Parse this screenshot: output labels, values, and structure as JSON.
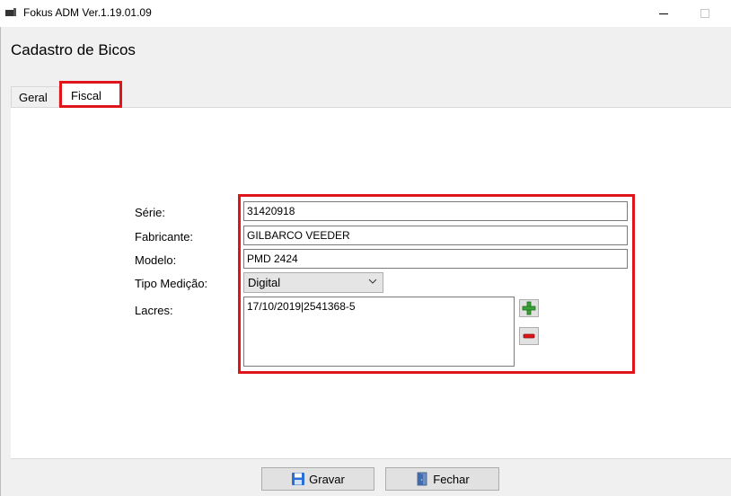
{
  "window": {
    "title": "Fokus ADM Ver.1.19.01.09"
  },
  "page": {
    "title": "Cadastro de Bicos"
  },
  "tabs": [
    {
      "label": "Geral",
      "active": false
    },
    {
      "label": "Fiscal",
      "active": true
    }
  ],
  "form": {
    "serie_label": "Série:",
    "serie_value": "31420918",
    "fabricante_label": "Fabricante:",
    "fabricante_value": "GILBARCO VEEDER",
    "modelo_label": "Modelo:",
    "modelo_value": "PMD 2424",
    "tipo_medicao_label": "Tipo Medição:",
    "tipo_medicao_value": "Digital",
    "lacres_label": "Lacres:",
    "lacres_items": [
      "17/10/2019|2541368-5"
    ]
  },
  "buttons": {
    "gravar_label": "Gravar",
    "fechar_label": "Fechar"
  },
  "icons": {
    "app": "app-icon",
    "add": "plus-icon",
    "remove": "minus-icon",
    "save": "floppy-disk-icon",
    "close": "exit-door-icon"
  },
  "colors": {
    "highlight": "#e0151b",
    "add_icon": "#3aa335",
    "remove_icon": "#e0151b",
    "save_icon": "#2a6fd6"
  }
}
